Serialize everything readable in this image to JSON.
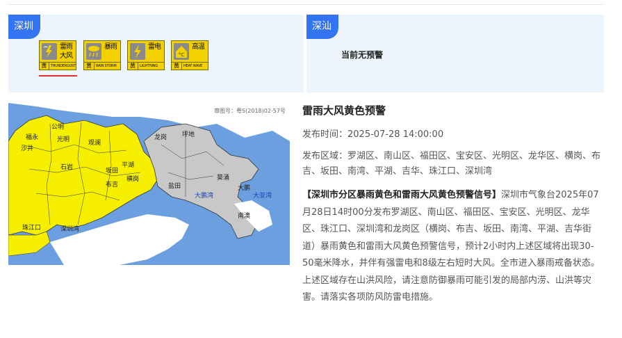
{
  "left_panel": {
    "city": "深圳",
    "signals": [
      {
        "name": "雷雨大风",
        "level": "黄",
        "en": "THUNDERGUST",
        "icon": "thunder-gust-icon"
      },
      {
        "name": "暴雨",
        "level": "黄",
        "en": "RAIN STORM",
        "icon": "rainstorm-icon"
      },
      {
        "name": "雷电",
        "level": "黄",
        "en": "LIGHTNING",
        "icon": "lightning-icon"
      },
      {
        "name": "高温",
        "level": "黄",
        "en": "HEAT WAVE",
        "icon": "heat-wave-icon"
      }
    ]
  },
  "right_panel": {
    "city": "深汕",
    "status": "当前无预警"
  },
  "map": {
    "approval_no": "审图号：粤S(2018)02-57号",
    "labels": [
      "坪地",
      "龙岗",
      "大鹏湾",
      "大亚湾",
      "南澳",
      "葵涌",
      "大鹏",
      "盐田",
      "沙井",
      "福永",
      "珠江口",
      "深圳湾",
      "公明",
      "光明",
      "石岩",
      "观澜",
      "平湖",
      "横岗",
      "布吉",
      "坂田"
    ]
  },
  "alert": {
    "title": "雷雨大风黄色预警",
    "time_label": "发布时间：",
    "time": "2025-07-28 14:00:00",
    "area_label": "发布区域：",
    "areas": "罗湖区、南山区、福田区、宝安区、光明区、龙华区、横岗、布吉、坂田、南湾、平湖、吉华、珠江口、深圳湾",
    "body_title": "【深圳市分区暴雨黄色和雷雨大风黄色预警信号】",
    "body": "深圳市气象台2025年07月28日14时00分发布罗湖区、南山区、福田区、宝安区、光明区、龙华区、珠江口、深圳湾和龙岗区（横岗、布吉、坂田、南湾、平湖、吉华街道）暴雨黄色和雷雨大风黄色预警信号，预计2小时内上述区域将出现30-50毫米降水，并伴有强雷电和8级左右短时大风。全市进入暴雨戒备状态。上述区域存在山洪风险，请注意防御暴雨可能引发的局部内涝、山洪等灾害。请落实各项防风防雷电措施。"
  },
  "colors": {
    "accent": "#3574f0",
    "warning_yellow": "#f3d000",
    "sea": "#6b9fe0",
    "underline": "#e0302a"
  }
}
